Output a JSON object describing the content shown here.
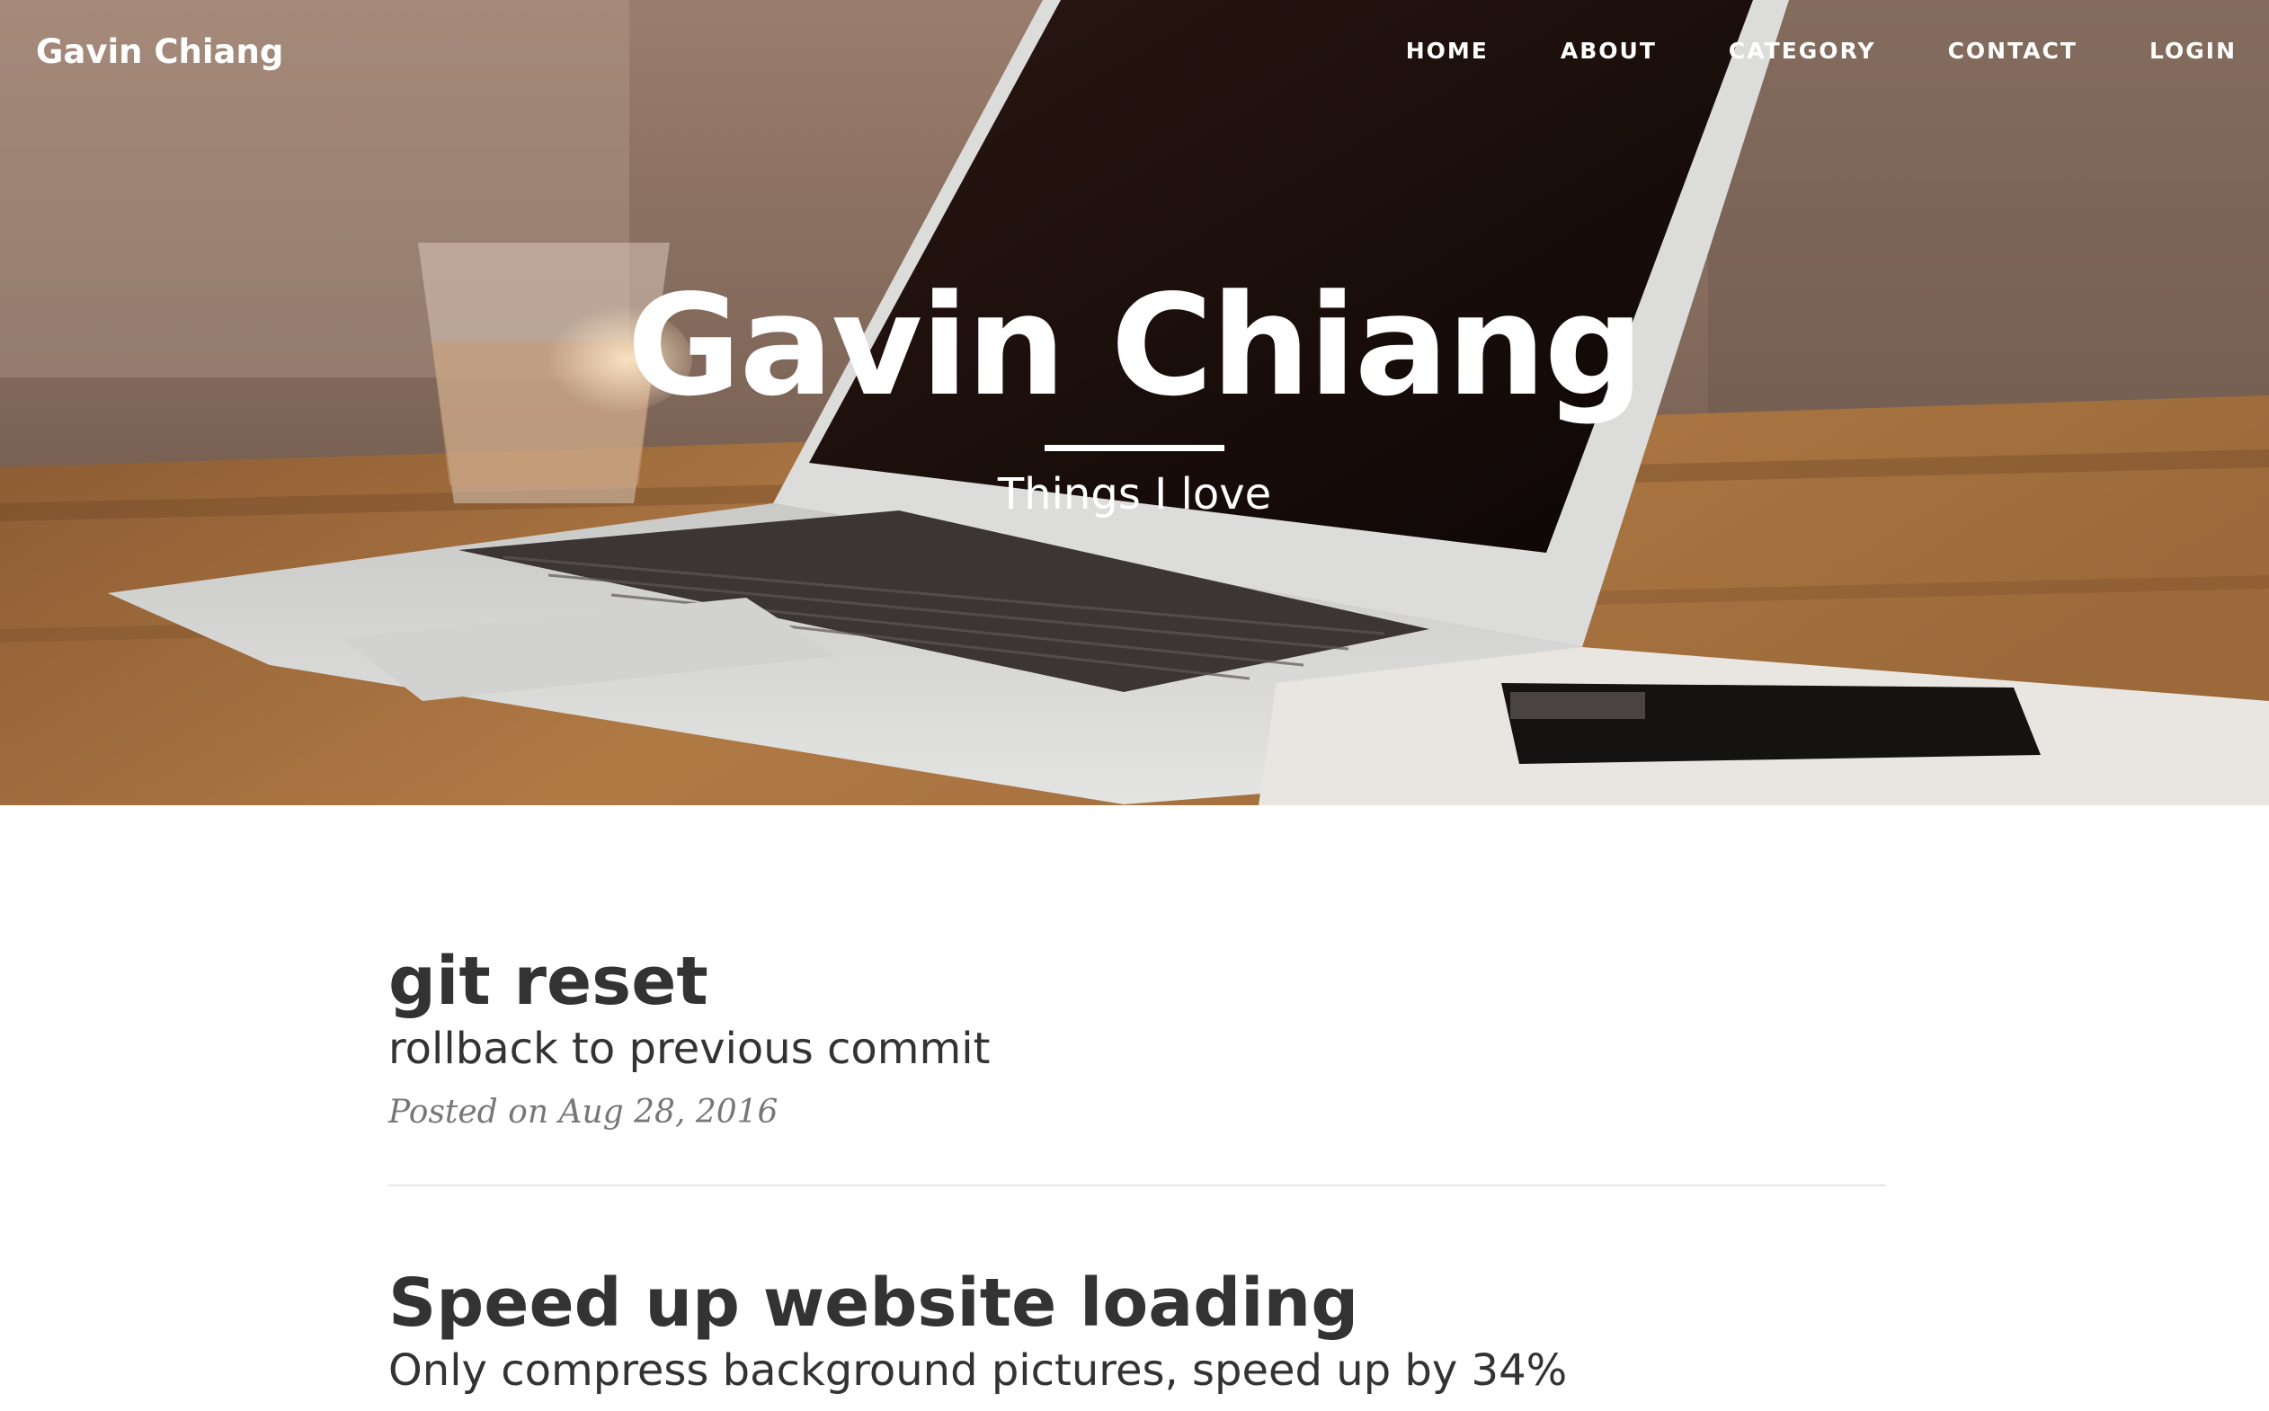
{
  "brand": "Gavin Chiang",
  "nav": {
    "items": [
      "HOME",
      "ABOUT",
      "CATEGORY",
      "CONTACT",
      "LOGIN"
    ]
  },
  "hero": {
    "title": "Gavin Chiang",
    "subtitle": "Things I love",
    "background": "laptop-on-wooden-desk-photo"
  },
  "posts": [
    {
      "title": "git reset",
      "subtitle": "rollback to previous commit",
      "meta": "Posted on Aug 28, 2016"
    },
    {
      "title": "Speed up website loading",
      "subtitle": "Only compress background pictures, speed up by 34%",
      "meta": ""
    }
  ],
  "colors": {
    "text": "#333333",
    "meta": "#777777",
    "divider": "#e6e6e6",
    "hero_text": "#ffffff"
  }
}
